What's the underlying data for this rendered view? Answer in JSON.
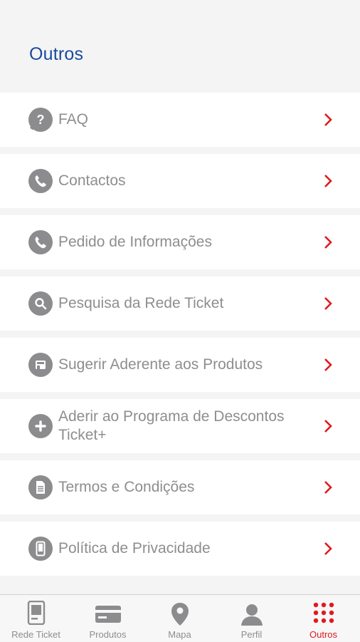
{
  "header": {
    "title": "Outros"
  },
  "menu": {
    "items": [
      {
        "label": "FAQ",
        "icon": "question-bubble-icon"
      },
      {
        "label": "Contactos",
        "icon": "phone-icon"
      },
      {
        "label": "Pedido de Informações",
        "icon": "phone-icon"
      },
      {
        "label": "Pesquisa da Rede Ticket",
        "icon": "search-icon"
      },
      {
        "label": "Sugerir Aderente aos Produtos",
        "icon": "store-icon"
      },
      {
        "label": "Aderir ao Programa de Descontos Ticket+",
        "icon": "plus-icon"
      },
      {
        "label": "Termos e Condições",
        "icon": "document-icon"
      },
      {
        "label": "Política de Privacidade",
        "icon": "mobile-icon"
      }
    ]
  },
  "tabbar": {
    "tabs": [
      {
        "label": "Rede Ticket",
        "icon": "device-icon",
        "active": false
      },
      {
        "label": "Produtos",
        "icon": "card-icon",
        "active": false
      },
      {
        "label": "Mapa",
        "icon": "map-pin-icon",
        "active": false
      },
      {
        "label": "Perfil",
        "icon": "user-icon",
        "active": false
      },
      {
        "label": "Outros",
        "icon": "grid-dots-icon",
        "active": true
      }
    ]
  },
  "colors": {
    "accent": "#e0191f",
    "title": "#1a4a9c",
    "icon_gray": "#8c8c8e",
    "text_gray": "#8e8e90"
  }
}
